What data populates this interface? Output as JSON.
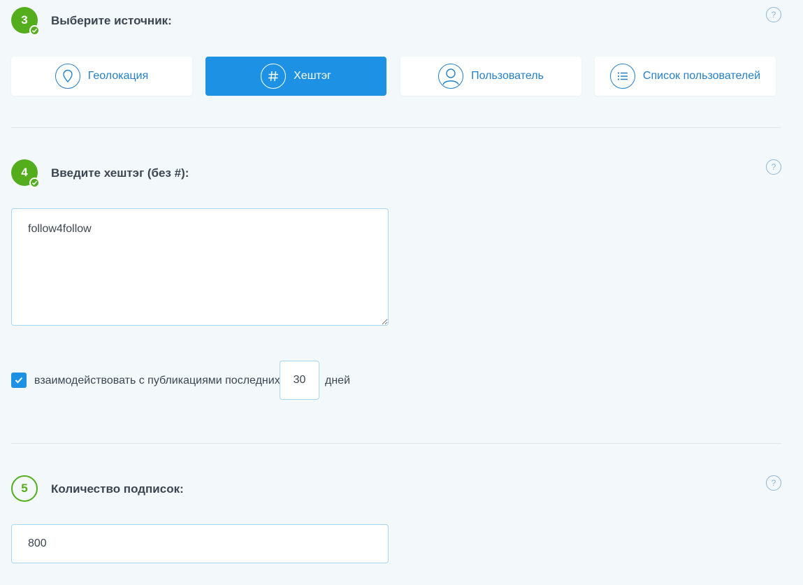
{
  "step3": {
    "number": "3",
    "title": "Выберите источник:",
    "help": "?",
    "sources": [
      {
        "label": "Геолокация",
        "icon": "location-pin-icon",
        "active": false
      },
      {
        "label": "Хештэг",
        "icon": "hashtag-icon",
        "active": true
      },
      {
        "label": "Пользователь",
        "icon": "user-icon",
        "active": false
      },
      {
        "label": "Список пользователей",
        "icon": "list-icon",
        "active": false
      }
    ]
  },
  "step4": {
    "number": "4",
    "title": "Введите хештэг (без #):",
    "help": "?",
    "hashtag_value": "follow4follow",
    "interact_checked": true,
    "interact_label": "взаимодействовать с публикациями последних",
    "days_value": "30",
    "days_label": "дней"
  },
  "step5": {
    "number": "5",
    "title": "Количество подписок:",
    "help": "?",
    "count_value": "800"
  },
  "colors": {
    "accent": "#1d91e3",
    "success": "#53ad1d",
    "link": "#2580c8",
    "background": "#f3f8fb"
  }
}
